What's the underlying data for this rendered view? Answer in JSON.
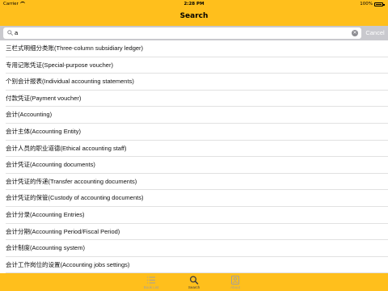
{
  "status_bar": {
    "carrier": "Carrier",
    "time": "2:28 PM",
    "battery": "100%"
  },
  "nav": {
    "title": "Search"
  },
  "search": {
    "value": "a",
    "cancel_label": "Cancel"
  },
  "results": [
    "三栏式明细分类账(Three-column subsidiary ledger)",
    "专用记账凭证(Special-purpose voucher)",
    "个别会计报表(Individual accounting statements)",
    "付款凭证(Payment voucher)",
    "会计(Accounting)",
    "会计主体(Accounting Entity)",
    "会计人员的职业道德(Ethical accounting staff)",
    "会计凭证(Accounting documents)",
    "会计凭证的传递(Transfer accounting documents)",
    "会计凭证的保管(Custody of accounting documents)",
    "会计分录(Accounting Entries)",
    "会计分期(Accounting Period/Fiscal Period)",
    "会计制度(Accounting system)",
    "会计工作岗位的设置(Accounting jobs settings)"
  ],
  "tabs": [
    {
      "label": "Book List",
      "icon": "list-icon",
      "active": false
    },
    {
      "label": "Search",
      "icon": "search-icon",
      "active": true
    },
    {
      "label": "About",
      "icon": "person-icon",
      "active": false
    }
  ],
  "colors": {
    "accent": "#ffbf1c",
    "search_bar_bg": "#c9c9ce",
    "tab_active": "#3a3a3a",
    "tab_inactive": "#a0a0a0"
  }
}
